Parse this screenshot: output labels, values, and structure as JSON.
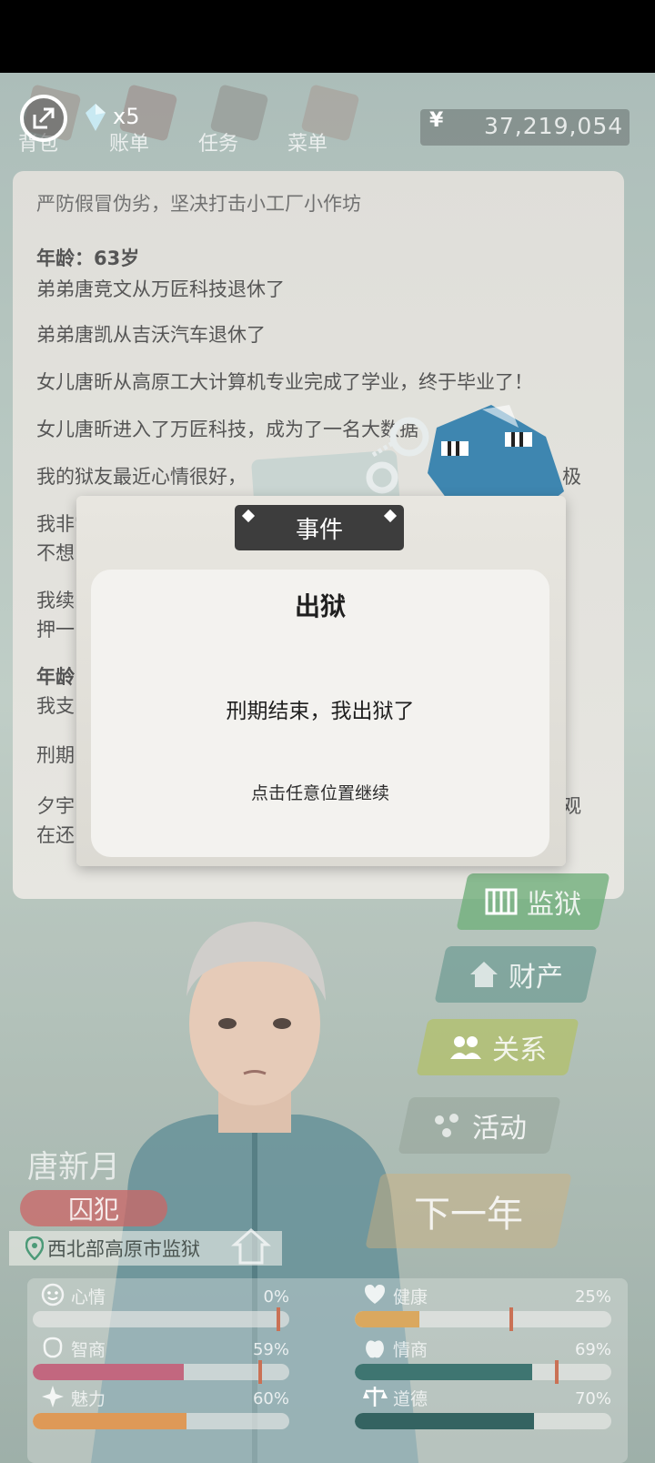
{
  "top_nav": {
    "items": [
      "背包",
      "账单",
      "任务",
      "菜单"
    ],
    "gem_count": "x5",
    "currency_symbol": "¥",
    "money": "37,219,054"
  },
  "log": {
    "lines": [
      {
        "text": "严防假冒伪劣，坚决打击小工厂小作坊",
        "bold": false
      },
      {
        "text": "年龄：63岁",
        "bold": true
      },
      {
        "text": "弟弟唐竞文从万匠科技退休了",
        "bold": false
      },
      {
        "text": "弟弟唐凯从吉沃汽车退休了",
        "bold": false
      },
      {
        "text": "女儿唐昕从高原工大计算机专业完成了学业，终于毕业了！",
        "bold": false
      },
      {
        "text": "女儿唐昕进入了万匠科技，成为了一名大数据",
        "bold": false
      },
      {
        "text": "我的狱友最近心情很好，",
        "bold": false
      },
      {
        "text": "我非常",
        "bold": false
      },
      {
        "text": "不想",
        "bold": false
      },
      {
        "text": "我续",
        "bold": false
      },
      {
        "text": "押一",
        "bold": false
      },
      {
        "text": "年龄",
        "bold": true
      },
      {
        "text": "我支",
        "bold": false
      },
      {
        "text": "刑期",
        "bold": false
      },
      {
        "text": "夕宇",
        "bold": false
      },
      {
        "text": "在还",
        "bold": false
      }
    ],
    "right_fragments": [
      "极",
      "观"
    ]
  },
  "event": {
    "tag": "事件",
    "title": "出狱",
    "body": "刑期结束，我出狱了",
    "hint": "点击任意位置继续"
  },
  "side_buttons": [
    {
      "label": "监狱",
      "icon": "prison-icon",
      "color": "#5aa366"
    },
    {
      "label": "财产",
      "icon": "house-icon",
      "color": "#3e7d74"
    },
    {
      "label": "关系",
      "icon": "people-icon",
      "color": "#a7b64a"
    },
    {
      "label": "活动",
      "icon": "dots-icon",
      "color": "#7b8a7e"
    },
    {
      "label": "下一年",
      "icon": "",
      "color": "#c9a468"
    }
  ],
  "character": {
    "name": "唐新月",
    "role": "囚犯",
    "location": "西北部高原市监狱"
  },
  "stats": [
    {
      "name": "心情",
      "value": "0%",
      "pct": 0,
      "color": "#9aa19d",
      "icon": "smile-icon"
    },
    {
      "name": "健康",
      "value": "25%",
      "pct": 25,
      "color": "#d49a45",
      "icon": "heart-icon"
    },
    {
      "name": "智商",
      "value": "59%",
      "pct": 59,
      "color": "#b84e6a",
      "icon": "brain-icon"
    },
    {
      "name": "情商",
      "value": "69%",
      "pct": 69,
      "color": "#1f5f5a",
      "icon": "apple-icon"
    },
    {
      "name": "魅力",
      "value": "60%",
      "pct": 60,
      "color": "#d9893c",
      "icon": "sparkle-icon"
    },
    {
      "name": "道德",
      "value": "70%",
      "pct": 70,
      "color": "#134a48",
      "icon": "scale-icon"
    }
  ]
}
